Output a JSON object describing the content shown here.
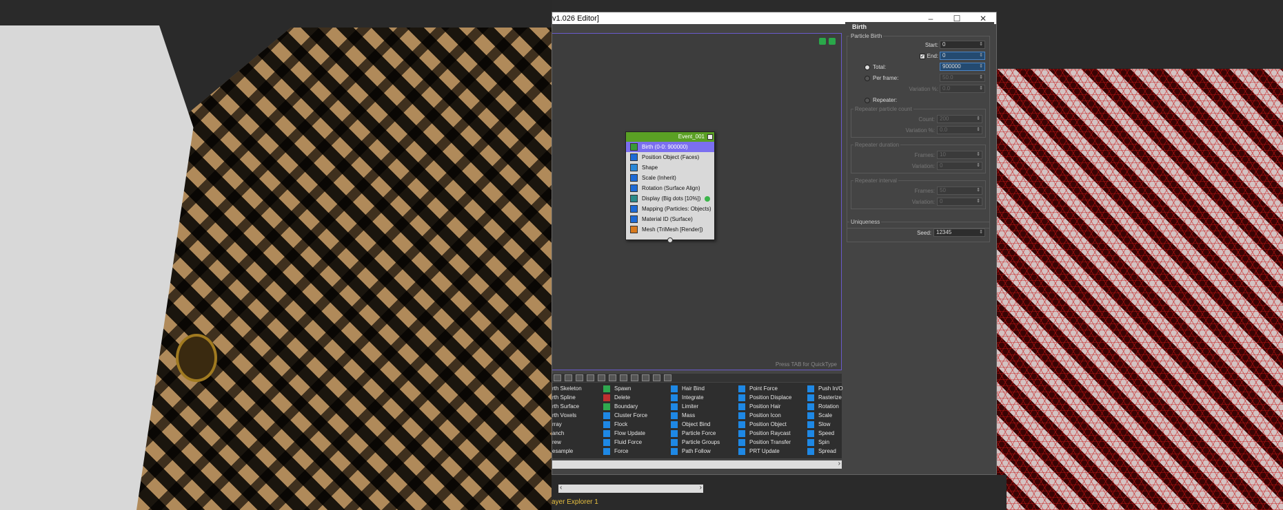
{
  "editor": {
    "title": "v1.026 Editor]",
    "quicktype_hint": "Press TAB for QuickType"
  },
  "event": {
    "name": "Event_001",
    "operators": [
      {
        "label": "Birth (0-0: 900000)",
        "icon": "birth-icon",
        "color": "#3a9a3a"
      },
      {
        "label": "Position Object (Faces)",
        "icon": "position-object-icon",
        "color": "#1e6bd6"
      },
      {
        "label": "Shape",
        "icon": "shape-icon",
        "color": "#2a88d8"
      },
      {
        "label": "Scale (Inherit)",
        "icon": "scale-icon",
        "color": "#1e6bd6"
      },
      {
        "label": "Rotation (Surface Align)",
        "icon": "rotation-icon",
        "color": "#1e6bd6"
      },
      {
        "label": "Display (Big dots [10%])",
        "icon": "display-icon",
        "color": "#2a8a8a"
      },
      {
        "label": "Mapping (Particles: Objects)",
        "icon": "mapping-icon",
        "color": "#1e6bd6"
      },
      {
        "label": "Material ID (Surface)",
        "icon": "material-icon",
        "color": "#1e6bd6"
      },
      {
        "label": "Mesh (TriMesh [Render])",
        "icon": "mesh-icon",
        "color": "#d87a1e"
      }
    ]
  },
  "depot": {
    "columns": [
      [
        "rth Skeleton",
        "rth Spline",
        "rth Surface",
        "rth Voxels",
        "rray",
        "anch",
        "rew",
        "esample"
      ],
      [
        "Spawn",
        "Delete",
        "Boundary",
        "Cluster Force",
        "Flock",
        "Flow Update",
        "Fluid Force",
        "Force"
      ],
      [
        "Hair Bind",
        "Integrate",
        "Limiter",
        "Mass",
        "Object Bind",
        "Particle Force",
        "Particle Groups",
        "Path Follow"
      ],
      [
        "Point Force",
        "Position Displace",
        "Position Hair",
        "Position Icon",
        "Position Object",
        "Position Raycast",
        "Position Transfer",
        "PRT Update"
      ],
      [
        "Push In/O",
        "Rasterize",
        "Rotation",
        "Scale",
        "Slow",
        "Speed",
        "Spin",
        "Spread"
      ]
    ]
  },
  "birth": {
    "rollout_title": "Birth",
    "group_title": "Particle Birth",
    "start_label": "Start:",
    "start_value": "0",
    "end_label": "End:",
    "end_value": "0",
    "total_label": "Total:",
    "total_value": "900000",
    "perframe_label": "Per frame:",
    "perframe_value": "50.0",
    "variation_label": "Variation %:",
    "variation_value": "0.0",
    "repeater_label": "Repeater:",
    "rep_count_group": "Repeater particle count",
    "count_label": "Count:",
    "count_value": "200",
    "rep_var_label": "Variation %:",
    "rep_var_value": "0.0",
    "rep_dur_group": "Repeater duration",
    "frames_label": "Frames:",
    "frames_value": "10",
    "dur_var_label": "Variation:",
    "dur_var_value": "0",
    "rep_int_group": "Repeater interval",
    "int_frames_label": "Frames:",
    "int_frames_value": "50",
    "int_var_label": "Variation:",
    "int_var_value": "0",
    "uniqueness_group": "Uniqueness",
    "seed_label": "Seed:",
    "seed_value": "12345"
  },
  "bottom": {
    "layer_explorer": "ayer Explorer 1"
  }
}
